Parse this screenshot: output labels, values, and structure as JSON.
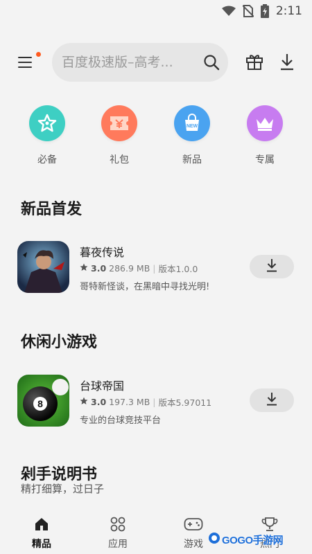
{
  "status_bar": {
    "time": "2:11"
  },
  "search": {
    "placeholder": "百度极速版–高考..."
  },
  "categories": [
    {
      "label": "必备",
      "icon": "star-icon",
      "color": "#3ecfc3"
    },
    {
      "label": "礼包",
      "icon": "ticket-icon",
      "color": "#ff7a5c"
    },
    {
      "label": "新品",
      "icon": "new-bag-icon",
      "color": "#4aa3f0"
    },
    {
      "label": "专属",
      "icon": "crown-icon",
      "color": "#c77cf0"
    }
  ],
  "sections": {
    "new_release": {
      "title": "新品首发",
      "app": {
        "name": "暮夜传说",
        "rating": "3.0",
        "size": "286.9 MB",
        "version": "版本1.0.0",
        "description": "哥特新怪谈，在黑暗中寻找光明!"
      }
    },
    "casual_games": {
      "title": "休闲小游戏",
      "app": {
        "name": "台球帝国",
        "rating": "3.0",
        "size": "197.3 MB",
        "version": "版本5.97011",
        "description": "专业的台球竞技平台"
      }
    },
    "shopping_guide": {
      "title": "剁手说明书",
      "subtitle": "精打细算，过日子"
    }
  },
  "bottom_nav": [
    {
      "label": "精品",
      "icon": "home-icon",
      "active": true
    },
    {
      "label": "应用",
      "icon": "apps-grid-icon",
      "active": false
    },
    {
      "label": "游戏",
      "icon": "gamepad-icon",
      "active": false
    },
    {
      "label": "热门",
      "icon": "trophy-icon",
      "active": false
    }
  ],
  "watermark": {
    "text": "GOGO手游网"
  }
}
